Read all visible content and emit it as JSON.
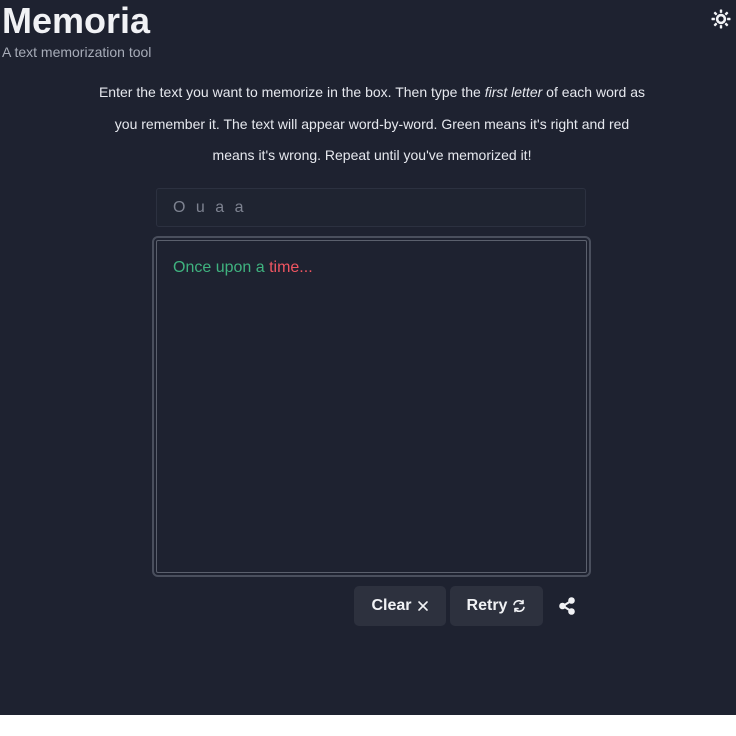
{
  "header": {
    "title": "Memoria",
    "subtitle": "A text memorization tool",
    "theme_icon": "sun-icon"
  },
  "intro": {
    "part1": "Enter the text you want to memorize in the box. Then type the ",
    "emphasis": "first letter",
    "part2": " of each word as you remember it. The text will appear word-by-word. Green means it's right and red means it's wrong. Repeat until you've memorized it!"
  },
  "input": {
    "value": "O u a a"
  },
  "output": {
    "words": [
      {
        "text": "Once upon a",
        "status": "correct"
      },
      {
        "text": "time...",
        "status": "wrong"
      }
    ],
    "colors": {
      "correct": "#3fb27f",
      "wrong": "#ef5561"
    }
  },
  "actions": {
    "clear_label": "Clear",
    "clear_icon": "close-icon",
    "retry_label": "Retry",
    "retry_icon": "refresh-icon",
    "share_icon": "share-icon"
  },
  "colors": {
    "background": "#1e2230",
    "button_bg": "#2d313e"
  }
}
